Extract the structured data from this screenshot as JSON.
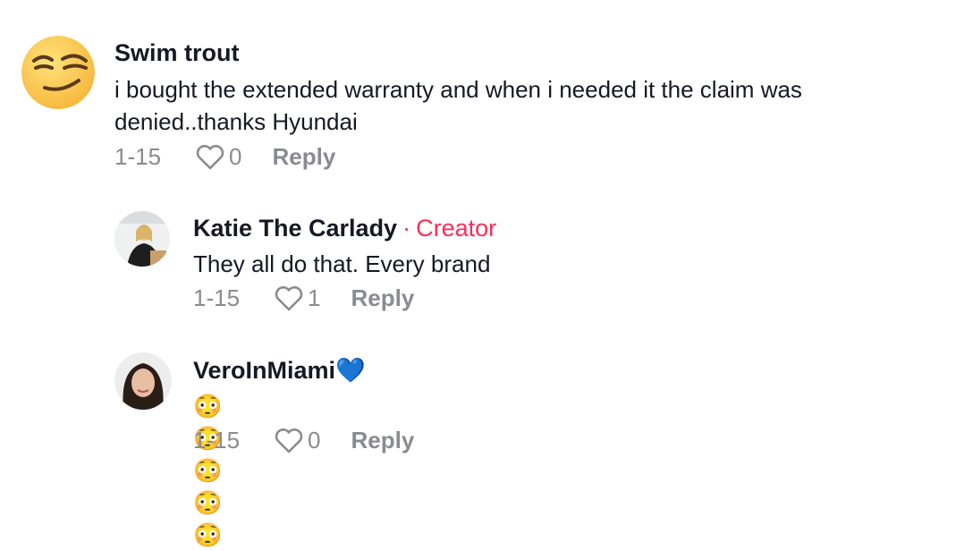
{
  "comments": [
    {
      "username": "Swim trout",
      "text": "i bought the extended warranty and when i needed it the claim was denied..thanks Hyundai",
      "date": "1-15",
      "likes": "0",
      "reply_label": "Reply",
      "avatar_icon": "smirk-emoji-avatar"
    },
    {
      "username": "Katie The Carlady",
      "separator": "·",
      "badge": "Creator",
      "text": "They all do that. Every brand",
      "date": "1-15",
      "likes": "1",
      "reply_label": "Reply",
      "avatar_icon": "profile-photo"
    },
    {
      "username": "VeroInMiami💙",
      "text": "😳😳😳😳😳",
      "date": "1-15",
      "likes": "0",
      "reply_label": "Reply",
      "avatar_icon": "profile-photo"
    }
  ],
  "colors": {
    "creator": "#fe2c55",
    "meta": "#8a8b91",
    "text": "#161823"
  }
}
